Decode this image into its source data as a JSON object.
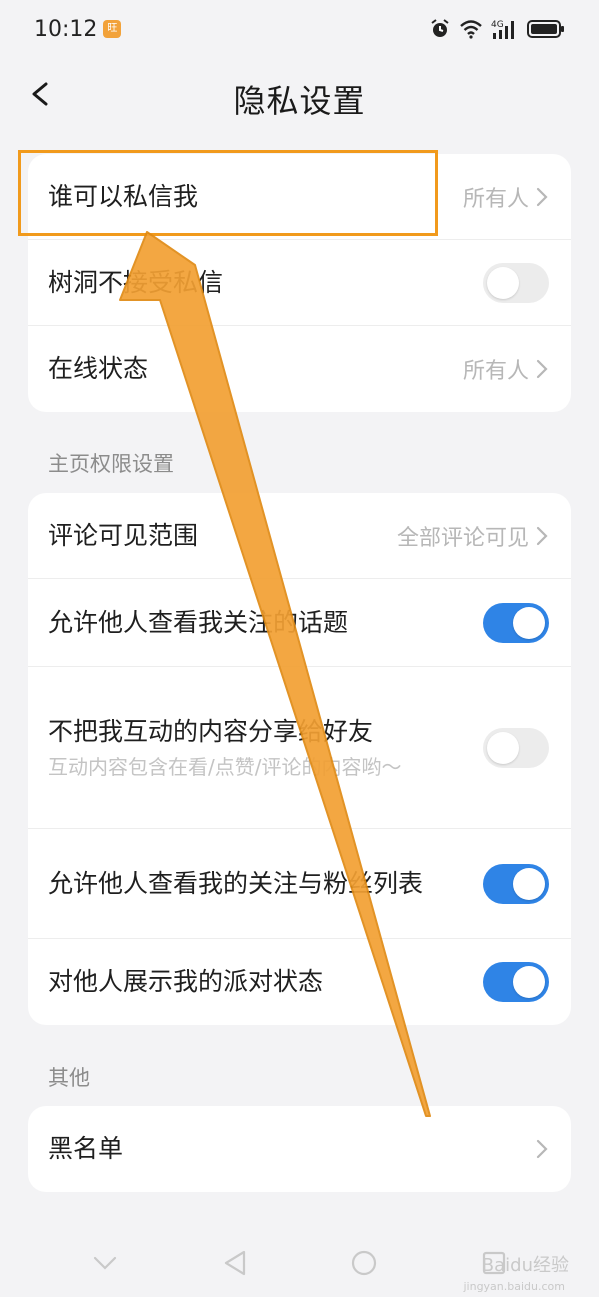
{
  "status_bar": {
    "time": "10:12",
    "badge": "旺"
  },
  "header": {
    "title": "隐私设置"
  },
  "card1": {
    "rows": [
      {
        "label": "谁可以私信我",
        "value": "所有人"
      },
      {
        "label": "树洞不接受私信",
        "toggle": "off"
      },
      {
        "label": "在线状态",
        "value": "所有人"
      }
    ]
  },
  "section_home": {
    "title": "主页权限设置"
  },
  "card2": {
    "rows": [
      {
        "label": "评论可见范围",
        "value": "全部评论可见"
      },
      {
        "label": "允许他人查看我关注的话题",
        "toggle": "on"
      },
      {
        "label": "不把我互动的内容分享给好友",
        "sub": "互动内容包含在看/点赞/评论的内容哟～",
        "toggle": "off"
      },
      {
        "label": "允许他人查看我的关注与粉丝列表",
        "toggle": "on"
      },
      {
        "label": "对他人展示我的派对状态",
        "toggle": "on"
      }
    ]
  },
  "section_other": {
    "title": "其他"
  },
  "card3": {
    "rows": [
      {
        "label": "黑名单"
      }
    ]
  },
  "watermark": {
    "text": "Baidu经验",
    "sub": "jingyan.baidu.com"
  },
  "colors": {
    "accent": "#2f84e6",
    "highlight": "#f19a1c"
  }
}
